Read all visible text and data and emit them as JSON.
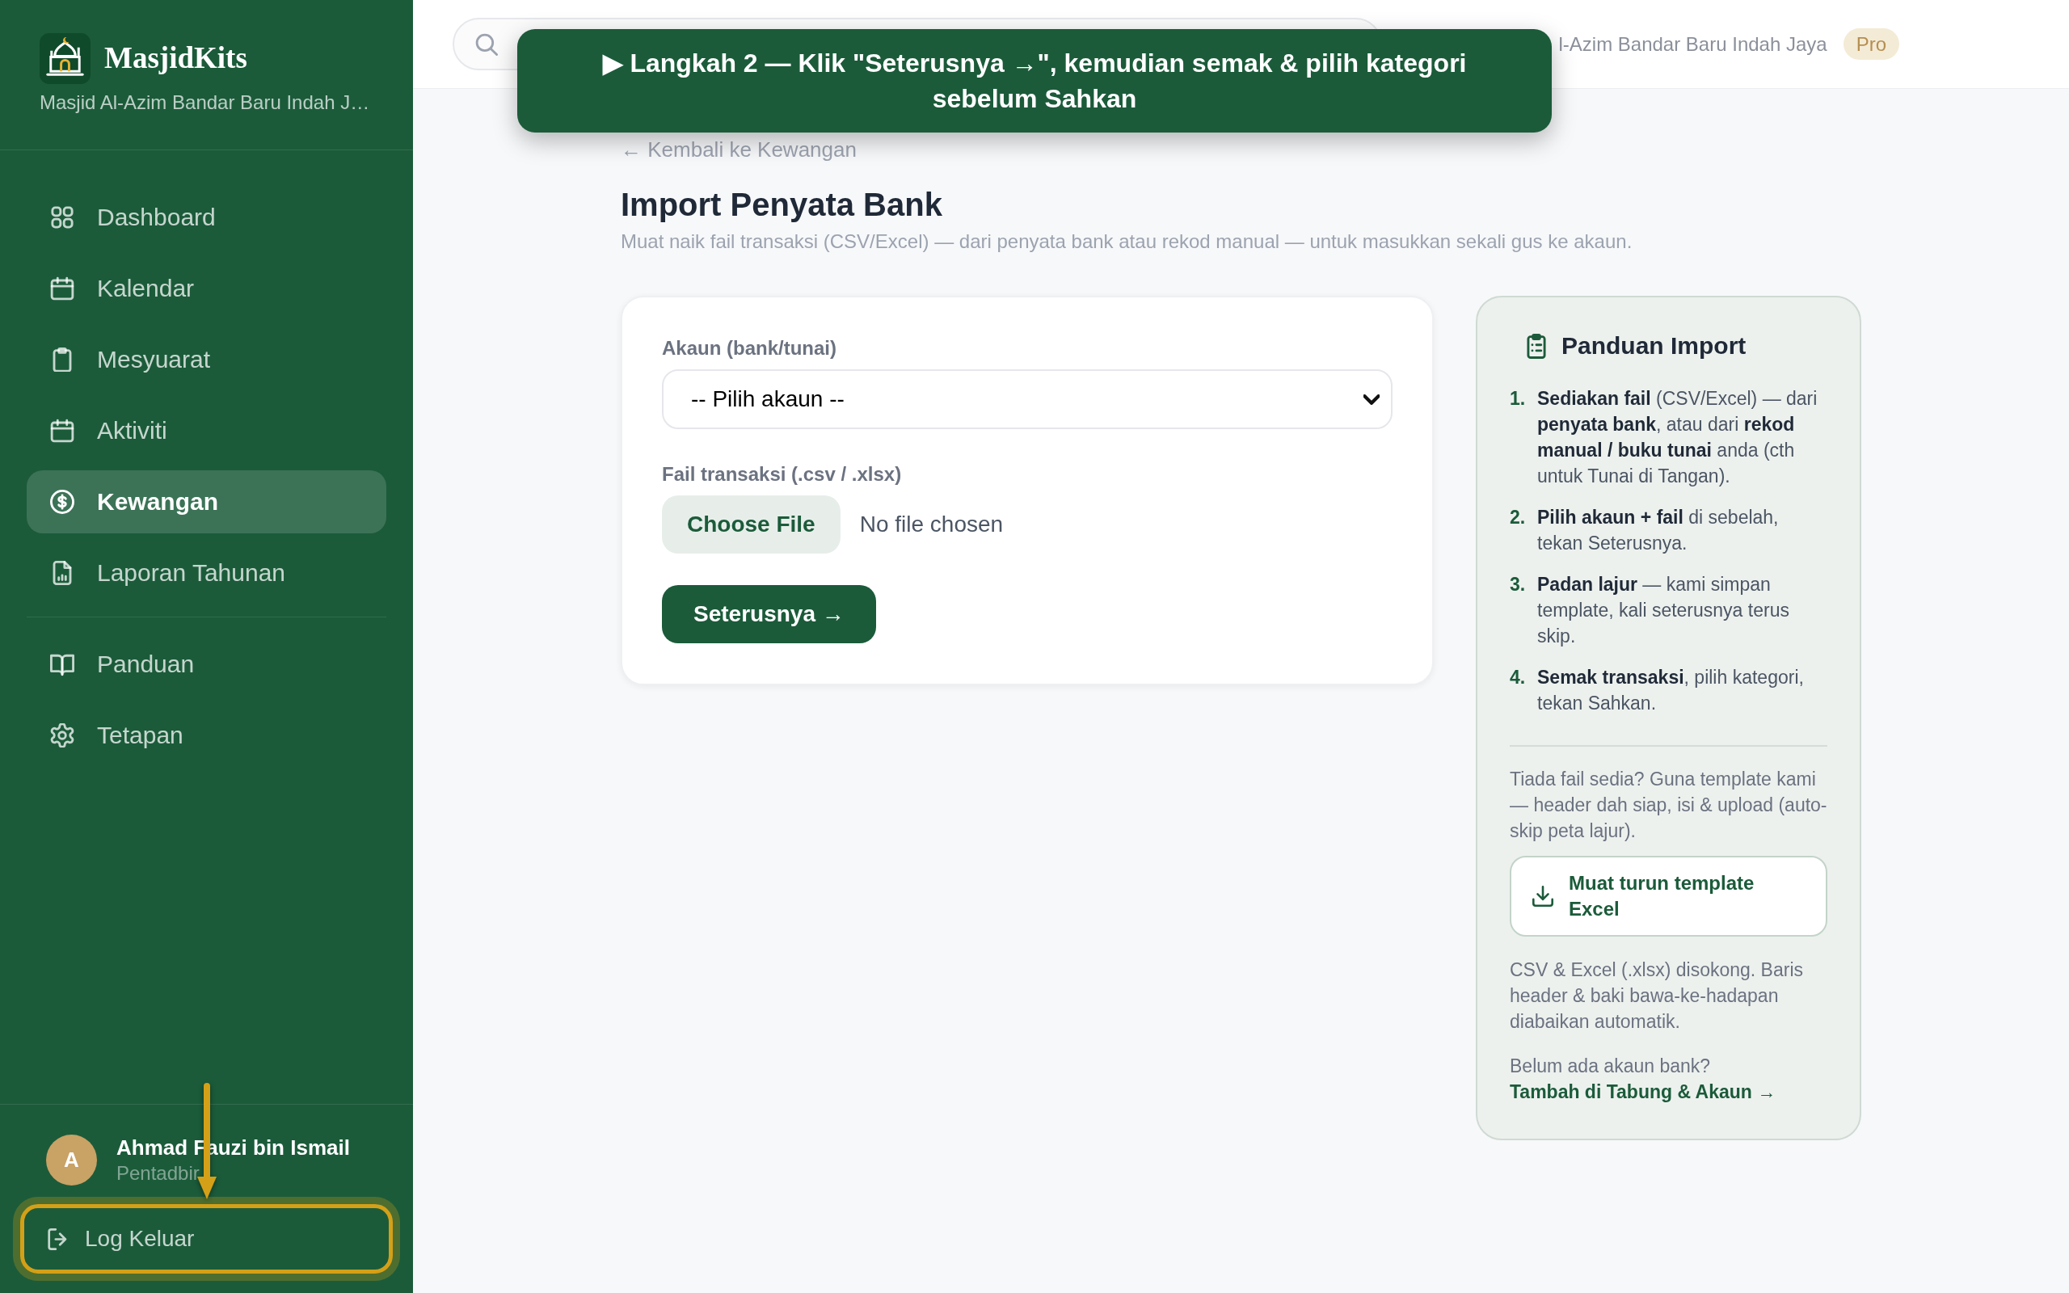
{
  "sidebar": {
    "brand": "MasjidKits",
    "subtitle": "Masjid Al-Azim Bandar Baru Indah J…",
    "nav_sections": [
      {
        "items": [
          {
            "label": "Dashboard",
            "selected": false
          },
          {
            "label": "Kalendar",
            "selected": false
          },
          {
            "label": "Mesyuarat",
            "selected": false
          },
          {
            "label": "Aktiviti",
            "selected": false
          },
          {
            "label": "Kewangan",
            "selected": true
          },
          {
            "label": "Laporan Tahunan",
            "selected": false
          }
        ]
      },
      {
        "items": [
          {
            "label": "Panduan",
            "selected": false
          },
          {
            "label": "Tetapan",
            "selected": false
          }
        ]
      }
    ],
    "user": {
      "initial": "A",
      "name": "Ahmad Fauzi bin Ismail",
      "role": "Pentadbir"
    },
    "logout": {
      "label": "Log Keluar",
      "highlighted": true
    }
  },
  "topbar": {
    "mosque_name": "l-Azim Bandar Baru Indah Jaya",
    "plan_badge": "Pro"
  },
  "tour_tooltip": "▶ Langkah 2 — Klik \"Seterusnya →\", kemudian semak & pilih kategori sebelum Sahkan",
  "page": {
    "back_link": "← Kembali ke Kewangan",
    "title": "Import Penyata Bank",
    "subtitle": "Muat naik fail transaksi (CSV/Excel) — dari penyata bank atau rekod manual — untuk masukkan sekali gus ke akaun."
  },
  "import_form": {
    "account_field": {
      "label": "Akaun (bank/tunai)",
      "value": "-- Pilih akaun --"
    },
    "file_field": {
      "label": "Fail transaksi (.csv / .xlsx)",
      "button": "Choose File",
      "status": "No file chosen"
    },
    "next_button": "Seterusnya →"
  },
  "guide": {
    "title": "Panduan Import",
    "steps": [
      {
        "number": "1.",
        "text": "**Sediakan fail** (CSV/Excel) — dari **penyata bank**, atau dari **rekod manual / buku tunai** anda (cth untuk Tunai di Tangan)."
      },
      {
        "number": "2.",
        "text": "**Pilih akaun + fail** di sebelah, tekan Seterusnya."
      },
      {
        "number": "3.",
        "text": "**Padan lajur** — kami simpan template, kali seterusnya terus skip."
      },
      {
        "number": "4.",
        "text": "**Semak transaksi**, pilih kategori, tekan Sahkan."
      }
    ],
    "template_note": "Tiada fail sedia? Guna template kami — header dah siap, isi & upload (auto-skip peta lajur).",
    "download_button": "Muat turun template Excel",
    "formats_note": "CSV & Excel (.xlsx) disokong. Baris header & baki bawa-ke-hadapan diabaikan automatik.",
    "no_account_note": {
      "text": "Belum ada akaun bank?",
      "link": "Tambah di Tabung & Akaun →"
    }
  }
}
